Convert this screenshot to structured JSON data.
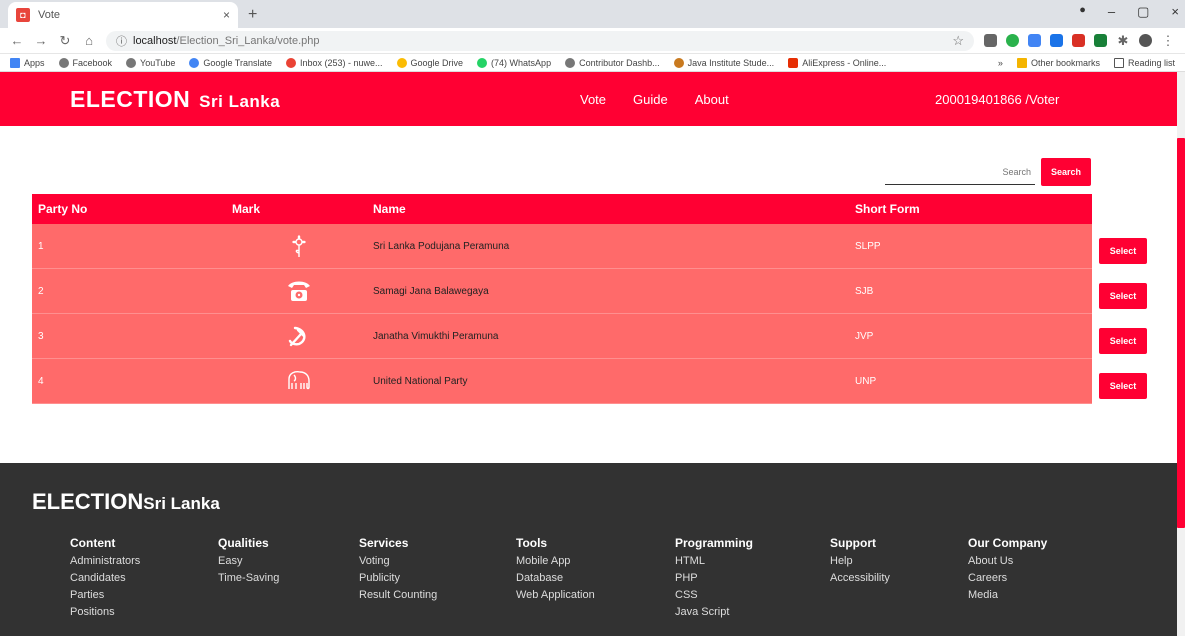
{
  "browser": {
    "tab_title": "Vote",
    "tab_favicon": "◘",
    "url_host": "localhost",
    "url_path": "/Election_Sri_Lanka/vote.php",
    "bookmarks": [
      "Apps",
      "Facebook",
      "YouTube",
      "Google Translate",
      "Inbox (253) - nuwe...",
      "Google Drive",
      "(74) WhatsApp",
      "Contributor Dashb...",
      "Java Institute Stude...",
      "AliExpress - Online..."
    ],
    "bookmarks_right": [
      "Other bookmarks",
      "Reading list"
    ]
  },
  "navbar": {
    "brand_main": "ELECTION",
    "brand_sub": "Sri Lanka",
    "links": [
      "Vote",
      "Guide",
      "About"
    ],
    "user": "200019401866 /Voter"
  },
  "search": {
    "placeholder": "Search",
    "button": "Search"
  },
  "table": {
    "headers": [
      "Party No",
      "Mark",
      "Name",
      "Short Form"
    ],
    "rows": [
      {
        "no": "1",
        "mark": "flower-icon",
        "name": "Sri Lanka Podujana Peramuna",
        "short": "SLPP",
        "action": "Select"
      },
      {
        "no": "2",
        "mark": "telephone-icon",
        "name": "Samagi Jana Balawegaya",
        "short": "SJB",
        "action": "Select"
      },
      {
        "no": "3",
        "mark": "hammer-sickle-icon",
        "name": "Janatha Vimukthi Peramuna",
        "short": "JVP",
        "action": "Select"
      },
      {
        "no": "4",
        "mark": "elephant-icon",
        "name": "United National Party",
        "short": "UNP",
        "action": "Select"
      }
    ]
  },
  "footer": {
    "brand_main": "ELECTION",
    "brand_sub": "Sri Lanka",
    "columns": [
      {
        "title": "Content",
        "items": [
          "Administrators",
          "Candidates",
          "Parties",
          "Positions"
        ]
      },
      {
        "title": "Qualities",
        "items": [
          "Easy",
          "Time-Saving"
        ]
      },
      {
        "title": "Services",
        "items": [
          "Voting",
          "Publicity",
          "Result Counting"
        ]
      },
      {
        "title": "Tools",
        "items": [
          "Mobile App",
          "Database",
          "Web Application"
        ]
      },
      {
        "title": "Programming",
        "items": [
          "HTML",
          "PHP",
          "CSS",
          "Java Script"
        ]
      },
      {
        "title": "Support",
        "items": [
          "Help",
          "Accessibility"
        ]
      },
      {
        "title": "Our Company",
        "items": [
          "About Us",
          "Careers",
          "Media"
        ]
      }
    ]
  },
  "colors": {
    "primary": "#ff0033",
    "row": "#ff6a6a",
    "footer": "#323232"
  }
}
